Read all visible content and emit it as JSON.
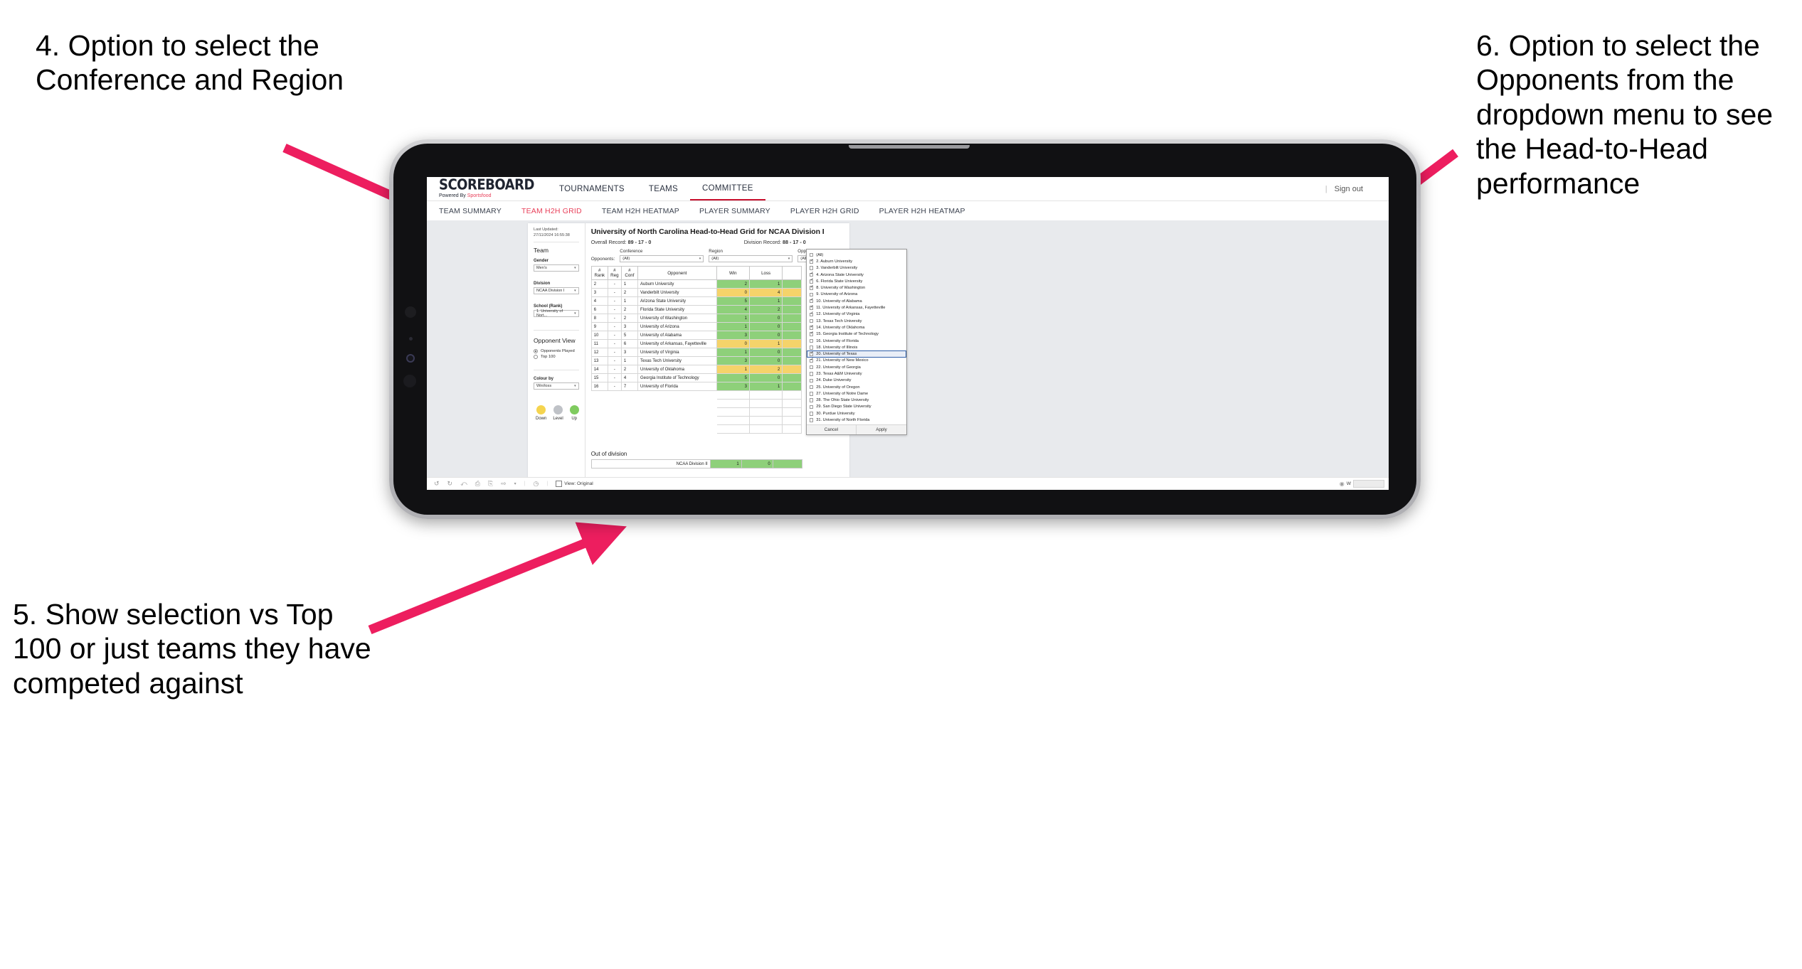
{
  "annotations": [
    {
      "id": "annot-4",
      "text": "4. Option to select the Conference and Region"
    },
    {
      "id": "annot-5",
      "text": "5. Show selection vs Top 100 or just teams they have competed against"
    },
    {
      "id": "annot-6",
      "text": "6. Option to select the Opponents from the dropdown menu to see the Head-to-Head performance"
    }
  ],
  "arrow_color": "#ed1e5f",
  "app": {
    "logo": {
      "main": "SCOREBOARD",
      "sub_prefix": "Powered By ",
      "sub_brand": "Sportsfood"
    },
    "top_nav": [
      {
        "label": "TOURNAMENTS",
        "active": false
      },
      {
        "label": "TEAMS",
        "active": false
      },
      {
        "label": "COMMITTEE",
        "active": true
      }
    ],
    "sign_out": "Sign out",
    "sub_nav": [
      {
        "label": "TEAM SUMMARY",
        "active": false
      },
      {
        "label": "TEAM H2H GRID",
        "active": true
      },
      {
        "label": "TEAM H2H HEATMAP",
        "active": false
      },
      {
        "label": "PLAYER SUMMARY",
        "active": false
      },
      {
        "label": "PLAYER H2H GRID",
        "active": false
      },
      {
        "label": "PLAYER H2H HEATMAP",
        "active": false
      }
    ],
    "left_panel": {
      "last_updated": "Last Updated: 27/11/2024 16:55:38",
      "team_heading": "Team",
      "gender_label": "Gender",
      "gender_value": "Men's",
      "division_label": "Division",
      "division_value": "NCAA Division I",
      "school_label": "School (Rank)",
      "school_value": "1. University of Nort...",
      "opponent_view_heading": "Opponent View",
      "opponent_view_options": [
        {
          "label": "Opponents Played",
          "selected": true
        },
        {
          "label": "Top 100",
          "selected": false
        }
      ],
      "colour_by_label": "Colour by",
      "colour_by_value": "Win/loss",
      "legend": [
        {
          "label": "Down",
          "color": "#f5d44f"
        },
        {
          "label": "Level",
          "color": "#bfc2c7"
        },
        {
          "label": "Up",
          "color": "#7fcb5f"
        }
      ]
    },
    "viz": {
      "title": "University of North Carolina Head-to-Head Grid for NCAA Division I",
      "overall_record_label": "Overall Record:",
      "overall_record_value": "89 - 17 - 0",
      "division_record_label": "Division Record:",
      "division_record_value": "88 - 17 - 0",
      "opponents_label": "Opponents:",
      "filters": [
        {
          "label": "Conference",
          "value": "(All)"
        },
        {
          "label": "Region",
          "value": "(All)"
        },
        {
          "label": "Opponent",
          "value": "(All)"
        }
      ],
      "table": {
        "headers": [
          "#\nRank",
          "#\nReg",
          "#\nConf",
          "Opponent",
          "Win",
          "Loss"
        ],
        "header_rank": "# Rank",
        "header_reg": "# Reg",
        "header_conf": "# Conf",
        "header_opponent": "Opponent",
        "header_win": "Win",
        "header_loss": "Loss",
        "rows": [
          {
            "rank": "2",
            "reg": "-",
            "conf": "1",
            "opponent": "Auburn University",
            "win": "2",
            "loss": "1",
            "state": "green"
          },
          {
            "rank": "3",
            "reg": "-",
            "conf": "2",
            "opponent": "Vanderbilt University",
            "win": "0",
            "loss": "4",
            "state": "amber"
          },
          {
            "rank": "4",
            "reg": "-",
            "conf": "1",
            "opponent": "Arizona State University",
            "win": "5",
            "loss": "1",
            "state": "green"
          },
          {
            "rank": "6",
            "reg": "-",
            "conf": "2",
            "opponent": "Florida State University",
            "win": "4",
            "loss": "2",
            "state": "green"
          },
          {
            "rank": "8",
            "reg": "-",
            "conf": "2",
            "opponent": "University of Washington",
            "win": "1",
            "loss": "0",
            "state": "green"
          },
          {
            "rank": "9",
            "reg": "-",
            "conf": "3",
            "opponent": "University of Arizona",
            "win": "1",
            "loss": "0",
            "state": "green"
          },
          {
            "rank": "10",
            "reg": "-",
            "conf": "5",
            "opponent": "University of Alabama",
            "win": "3",
            "loss": "0",
            "state": "green"
          },
          {
            "rank": "11",
            "reg": "-",
            "conf": "6",
            "opponent": "University of Arkansas, Fayetteville",
            "win": "0",
            "loss": "1",
            "state": "amber"
          },
          {
            "rank": "12",
            "reg": "-",
            "conf": "3",
            "opponent": "University of Virginia",
            "win": "1",
            "loss": "0",
            "state": "green"
          },
          {
            "rank": "13",
            "reg": "-",
            "conf": "1",
            "opponent": "Texas Tech University",
            "win": "3",
            "loss": "0",
            "state": "green"
          },
          {
            "rank": "14",
            "reg": "-",
            "conf": "2",
            "opponent": "University of Oklahoma",
            "win": "1",
            "loss": "2",
            "state": "amber"
          },
          {
            "rank": "15",
            "reg": "-",
            "conf": "4",
            "opponent": "Georgia Institute of Technology",
            "win": "5",
            "loss": "0",
            "state": "green"
          },
          {
            "rank": "16",
            "reg": "-",
            "conf": "7",
            "opponent": "University of Florida",
            "win": "3",
            "loss": "1",
            "state": "green"
          }
        ]
      },
      "out_of_division": {
        "title": "Out of division",
        "row": {
          "name": "NCAA Division II",
          "win": "1",
          "loss": "0"
        }
      }
    },
    "opponent_dropdown": {
      "items": [
        {
          "label": "(All)",
          "checked": false,
          "highlighted": false
        },
        {
          "label": "2. Auburn University",
          "checked": true,
          "highlighted": false
        },
        {
          "label": "3. Vanderbilt University",
          "checked": false,
          "highlighted": false
        },
        {
          "label": "4. Arizona State University",
          "checked": true,
          "highlighted": false
        },
        {
          "label": "6. Florida State University",
          "checked": true,
          "highlighted": false
        },
        {
          "label": "8. University of Washington",
          "checked": true,
          "highlighted": false
        },
        {
          "label": "9. University of Arizona",
          "checked": false,
          "highlighted": false
        },
        {
          "label": "10. University of Alabama",
          "checked": true,
          "highlighted": false
        },
        {
          "label": "11. University of Arkansas, Fayetteville",
          "checked": true,
          "highlighted": false
        },
        {
          "label": "12. University of Virginia",
          "checked": true,
          "highlighted": false
        },
        {
          "label": "13. Texas Tech University",
          "checked": false,
          "highlighted": false
        },
        {
          "label": "14. University of Oklahoma",
          "checked": true,
          "highlighted": false
        },
        {
          "label": "15. Georgia Institute of Technology",
          "checked": true,
          "highlighted": false
        },
        {
          "label": "16. University of Florida",
          "checked": false,
          "highlighted": false
        },
        {
          "label": "18. University of Illinois",
          "checked": false,
          "highlighted": false
        },
        {
          "label": "20. University of Texas",
          "checked": true,
          "highlighted": true
        },
        {
          "label": "21. University of New Mexico",
          "checked": true,
          "highlighted": false
        },
        {
          "label": "22. University of Georgia",
          "checked": false,
          "highlighted": false
        },
        {
          "label": "23. Texas A&M University",
          "checked": false,
          "highlighted": false
        },
        {
          "label": "24. Duke University",
          "checked": false,
          "highlighted": false
        },
        {
          "label": "25. University of Oregon",
          "checked": false,
          "highlighted": false
        },
        {
          "label": "27. University of Notre Dame",
          "checked": false,
          "highlighted": false
        },
        {
          "label": "28. The Ohio State University",
          "checked": false,
          "highlighted": false
        },
        {
          "label": "29. San Diego State University",
          "checked": false,
          "highlighted": false
        },
        {
          "label": "30. Purdue University",
          "checked": false,
          "highlighted": false
        },
        {
          "label": "31. University of North Florida",
          "checked": false,
          "highlighted": false
        }
      ],
      "cancel_label": "Cancel",
      "apply_label": "Apply"
    },
    "toolbar": {
      "view_label": "View: Original",
      "icons": [
        "undo-icon",
        "redo-icon",
        "revert-icon",
        "pause-refresh-icon",
        "refresh-icon",
        "share-icon",
        "history-icon"
      ]
    }
  }
}
